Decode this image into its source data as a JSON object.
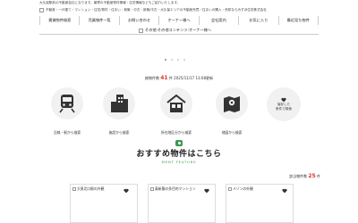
{
  "header": {
    "notice": "大久保駅前の不動産会社になります。最寄の不動産物件情報・住宅情報などもご紹介いたします。",
    "brandline": "不動産・一戸建て・マンション・住宅/物件・住まい・新築・中古・新築/中古・大久保エリアの不動産売買／住まいの購入・売却ならみずほ住宅株式会社"
  },
  "nav": {
    "items": [
      {
        "label": "賃貸物件検索"
      },
      {
        "label": "売買物件一覧"
      },
      {
        "label": "お問い合わせ"
      },
      {
        "label": "オーナー様へ"
      },
      {
        "label": "会社案内"
      },
      {
        "label": "お気に入り"
      },
      {
        "label": "最近見た物件"
      }
    ],
    "sub_label": "その他:その他コンテンツ:オーナー様へ"
  },
  "stats": {
    "prefix": "総物件数",
    "count": "41",
    "suffix": "件  2025/11/17 13:08更新"
  },
  "categories": [
    {
      "label": "沿線・駅から検索",
      "icon": "train-icon"
    },
    {
      "label": "施設から検索",
      "icon": "building-icon"
    },
    {
      "label": "所在地区分から検索",
      "icon": "house-icon"
    },
    {
      "label": "地図から検索",
      "icon": "map-icon"
    }
  ],
  "favorites": {
    "line1": "保存した",
    "line2": "条件で検索"
  },
  "recommend": {
    "title": "おすすめ物件はこちら",
    "subtitle": "MENT FEATURE"
  },
  "total": {
    "prefix": "該当物件数",
    "count": "25",
    "suffix": "件"
  },
  "cards": [
    {
      "title": "大泉北口駅の外観"
    },
    {
      "title": "真新築の多目的マンション"
    },
    {
      "title": "メゾンの外観"
    }
  ],
  "colors": {
    "accent_red": "#d23a2a",
    "accent_green": "#3a9a4a",
    "icon_dark": "#333333"
  }
}
